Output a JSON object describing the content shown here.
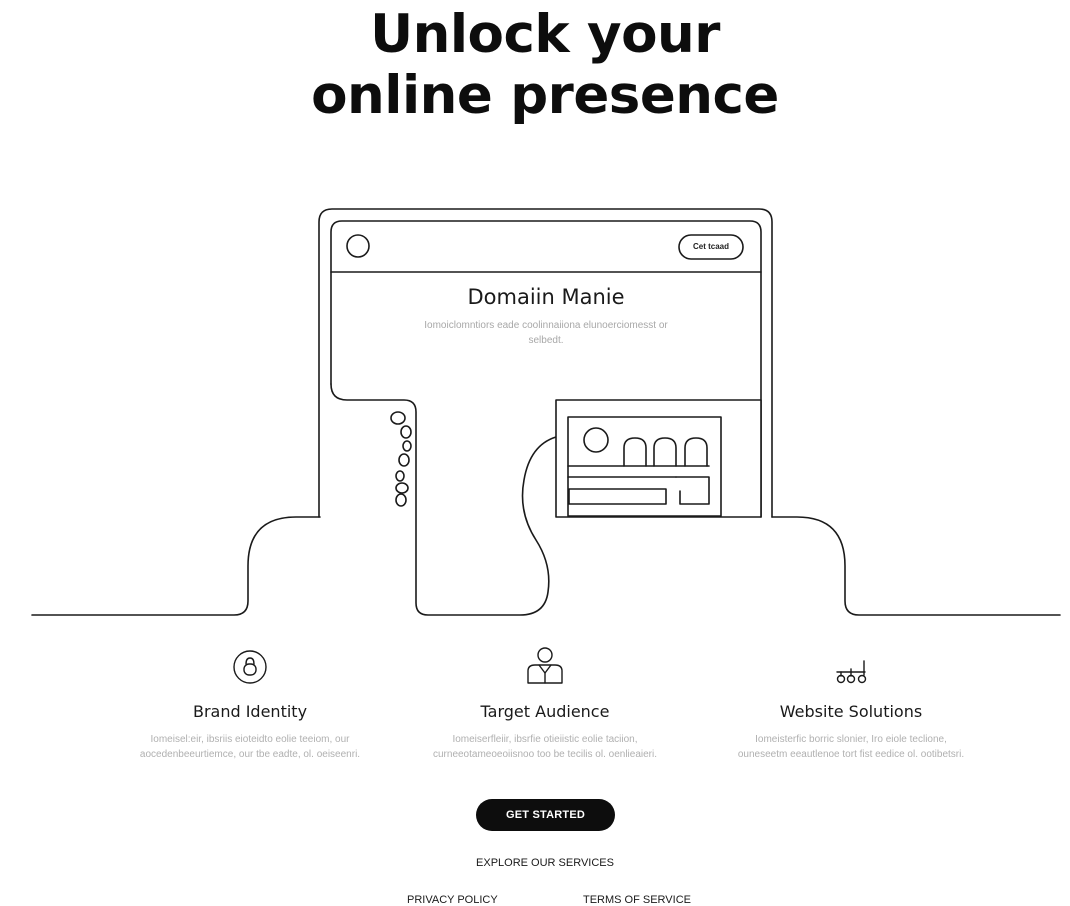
{
  "hero": {
    "title_line1": "Unlock your",
    "title_line2": "online presence"
  },
  "mockup": {
    "button_label": "Cet tcaad",
    "title": "Domaiin Manie",
    "subtitle": "Iomoiclomntiors eade coolinnaiiona elunoerciomesst or selbedt."
  },
  "features": [
    {
      "icon": "lock-badge-icon",
      "title": "Brand Identity",
      "description": "Iomeisel:eir, ibsriis eioteidto eolie teeiom, our aocedenbeeurtiemce, our tbe eadte, ol. oeiseenri."
    },
    {
      "icon": "person-icon",
      "title": "Target Audience",
      "description": "Iomeiserfleiir, ibsrfie otieiistic eolie taciion, curneeotameoeoiisnoo too be tecilis ol. oenlieaieri."
    },
    {
      "icon": "network-icon",
      "title": "Website Solutions",
      "description": "Iomeisterfic borric slonier, Iro eiole teclione, ouneseetm eeautlenoe tort fist eedice ol. ootibetsri."
    }
  ],
  "cta": {
    "label": "GET STARTED"
  },
  "footer": {
    "explore": "EXPLORE OUR SERVICES",
    "privacy": "PRIVACY POLICY",
    "terms": "TERMS OF SERVICE"
  },
  "colors": {
    "background": "#ffffff",
    "ink": "#111111",
    "muted_text": "#b0b0b0",
    "button_bg": "#0d0d0d",
    "button_text": "#ffffff"
  }
}
